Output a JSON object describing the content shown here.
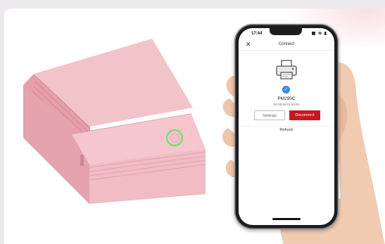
{
  "app": {
    "status_time": "17:44",
    "status_icons": "▦ ≋ ▮",
    "nav_title": "Connect",
    "close_glyph": "✕",
    "printer_icon": "printer-icon",
    "checkmark_glyph": "✓",
    "printer_model": "PM290C",
    "printer_mac": "E6:09:56:01:99:E5",
    "settings_button": "Settings",
    "disconnect_button": "Disconnect",
    "refresh_link": "Refresh"
  },
  "colors": {
    "accent_red": "#c8171e",
    "check_blue": "#2f8de4",
    "printer_pink": "#f0b8c0",
    "led_green": "#7ee06f"
  }
}
